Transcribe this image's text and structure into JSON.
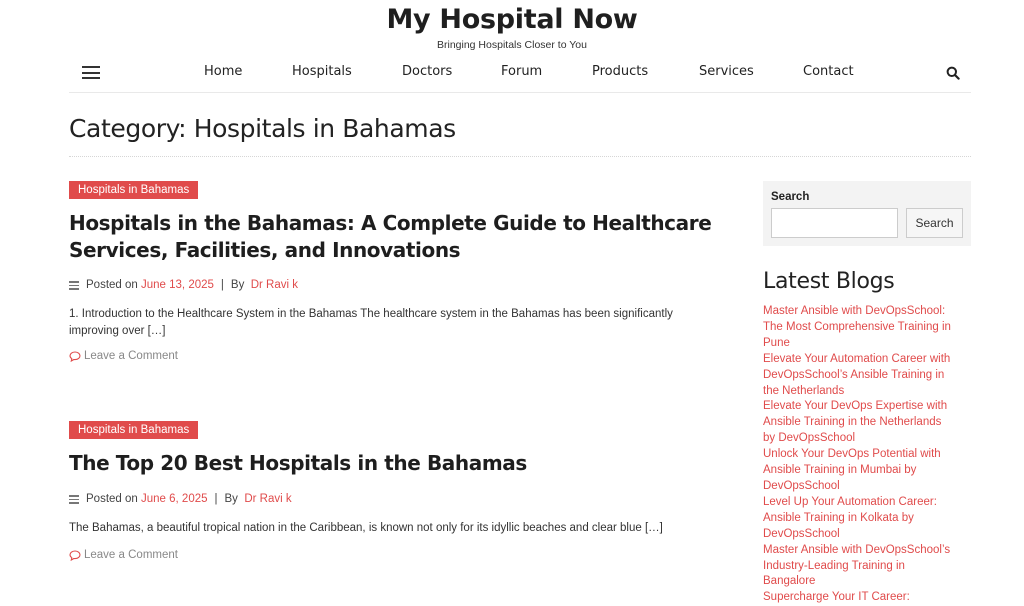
{
  "site": {
    "title": "My Hospital Now",
    "tagline": "Bringing Hospitals Closer to You"
  },
  "nav": {
    "items": [
      "Home",
      "Hospitals",
      "Doctors",
      "Forum",
      "Products",
      "Services",
      "Contact"
    ]
  },
  "page": {
    "category_title": "Category: Hospitals in Bahamas"
  },
  "posts": [
    {
      "category": "Hospitals in Bahamas",
      "title_line1": "Hospitals in the Bahamas: A Complete Guide to Healthcare",
      "title_line2": "Services, Facilities, and Innovations",
      "posted_on_label": "Posted on",
      "date": "June 13, 2025",
      "by_label": "By",
      "author": "Dr Ravi k",
      "excerpt_line1": "1. Introduction to the Healthcare System in the Bahamas The healthcare system in the Bahamas has been significantly",
      "excerpt_line2": "improving over […]",
      "comment_label": "Leave a Comment"
    },
    {
      "category": "Hospitals in Bahamas",
      "title_line1": "The Top 20 Best Hospitals in the Bahamas",
      "posted_on_label": "Posted on",
      "date": "June 6, 2025",
      "by_label": "By",
      "author": "Dr Ravi k",
      "excerpt_line1": "The Bahamas, a beautiful tropical nation in the Caribbean, is known not only for its idyllic beaches and clear blue […]",
      "comment_label": "Leave a Comment"
    }
  ],
  "sidebar": {
    "search": {
      "label": "Search",
      "value": "",
      "button_label": "Search"
    },
    "latest_title": "Latest Blogs",
    "latest_lines": [
      "Master Ansible with DevOpsSchool:",
      "The Most Comprehensive Training in",
      "Pune",
      "Elevate Your Automation Career with",
      "DevOpsSchool’s Ansible Training in",
      "the Netherlands",
      "Elevate Your DevOps Expertise with",
      "Ansible Training in the Netherlands",
      "by DevOpsSchool",
      "Unlock Your DevOps Potential with",
      "Ansible Training in Mumbai by",
      "DevOpsSchool",
      "Level Up Your Automation Career:",
      "Ansible Training in Kolkata by",
      "DevOpsSchool",
      "Master Ansible with DevOpsSchool’s",
      "Industry-Leading Training in",
      "Bangalore",
      "Supercharge Your IT Career:"
    ]
  },
  "colors": {
    "accent": "#e04b4b",
    "text": "#222222",
    "widget_bg": "#f3f3f3"
  },
  "icons": {
    "menu": "hamburger-icon",
    "search": "search-icon",
    "meta": "lines-icon",
    "comment": "comment-bubble-icon"
  }
}
